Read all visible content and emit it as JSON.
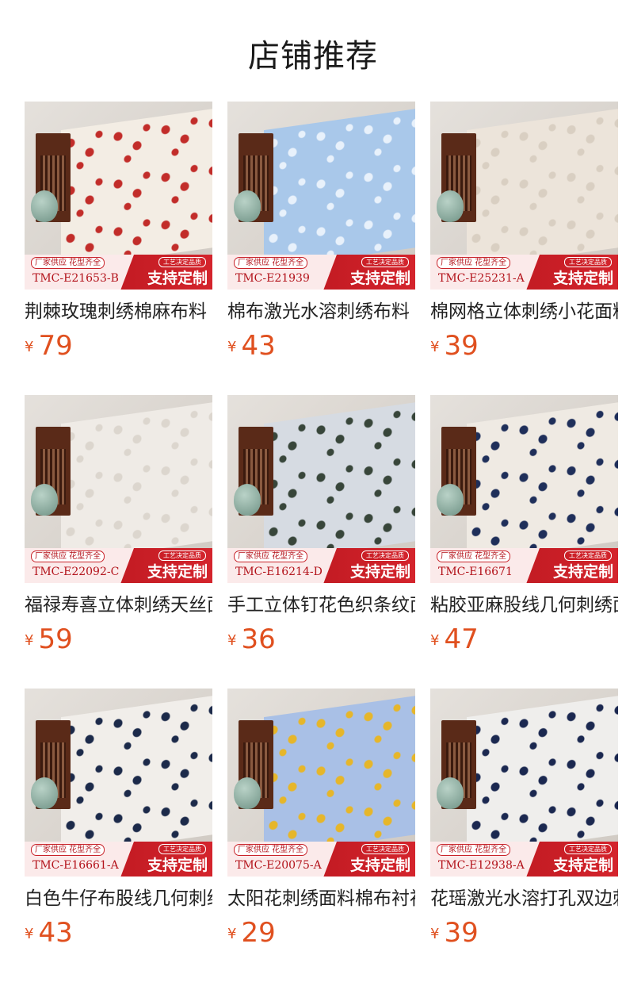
{
  "section_title": "店铺推荐",
  "banner_text": {
    "tag": "厂家供应  花型齐全",
    "craft": "工艺决定品质",
    "custom": "支持定制"
  },
  "products": [
    {
      "name": "荆棘玫瑰刺绣棉麻布料",
      "code": "TMC-E21653-B",
      "currency": "¥",
      "price": "79",
      "swatch": "#f3ede4",
      "accent": "#c22d2a"
    },
    {
      "name": "棉布激光水溶刺绣布料",
      "code": "TMC-E21939",
      "currency": "¥",
      "price": "43",
      "swatch": "#a9c8ea",
      "accent": "#e8f1fb"
    },
    {
      "name": "棉网格立体刺绣小花面料",
      "code": "TMC-E25231-A",
      "currency": "¥",
      "price": "39",
      "swatch": "#ece4da",
      "accent": "#d9cfc2"
    },
    {
      "name": "福禄寿喜立体刺绣天丝面料",
      "code": "TMC-E22092-C",
      "currency": "¥",
      "price": "59",
      "swatch": "#efebe6",
      "accent": "#dcd6ce"
    },
    {
      "name": "手工立体钉花色织条纹面料",
      "code": "TMC-E16214-D",
      "currency": "¥",
      "price": "36",
      "swatch": "#d6dbe2",
      "accent": "#38463a"
    },
    {
      "name": "粘胶亚麻股线几何刺绣面料",
      "code": "TMC-E16671",
      "currency": "¥",
      "price": "47",
      "swatch": "#efeae3",
      "accent": "#1f2f5a"
    },
    {
      "name": "白色牛仔布股线几何刺绣",
      "code": "TMC-E16661-A",
      "currency": "¥",
      "price": "43",
      "swatch": "#f1eeea",
      "accent": "#1c2a4a"
    },
    {
      "name": "太阳花刺绣面料棉布衬衫",
      "code": "TMC-E20075-A",
      "currency": "¥",
      "price": "29",
      "swatch": "#a9c0e6",
      "accent": "#e6b62a"
    },
    {
      "name": "花瑶激光水溶打孔双边刺绣",
      "code": "TMC-E12938-A",
      "currency": "¥",
      "price": "39",
      "swatch": "#efeeec",
      "accent": "#1b2850"
    }
  ]
}
